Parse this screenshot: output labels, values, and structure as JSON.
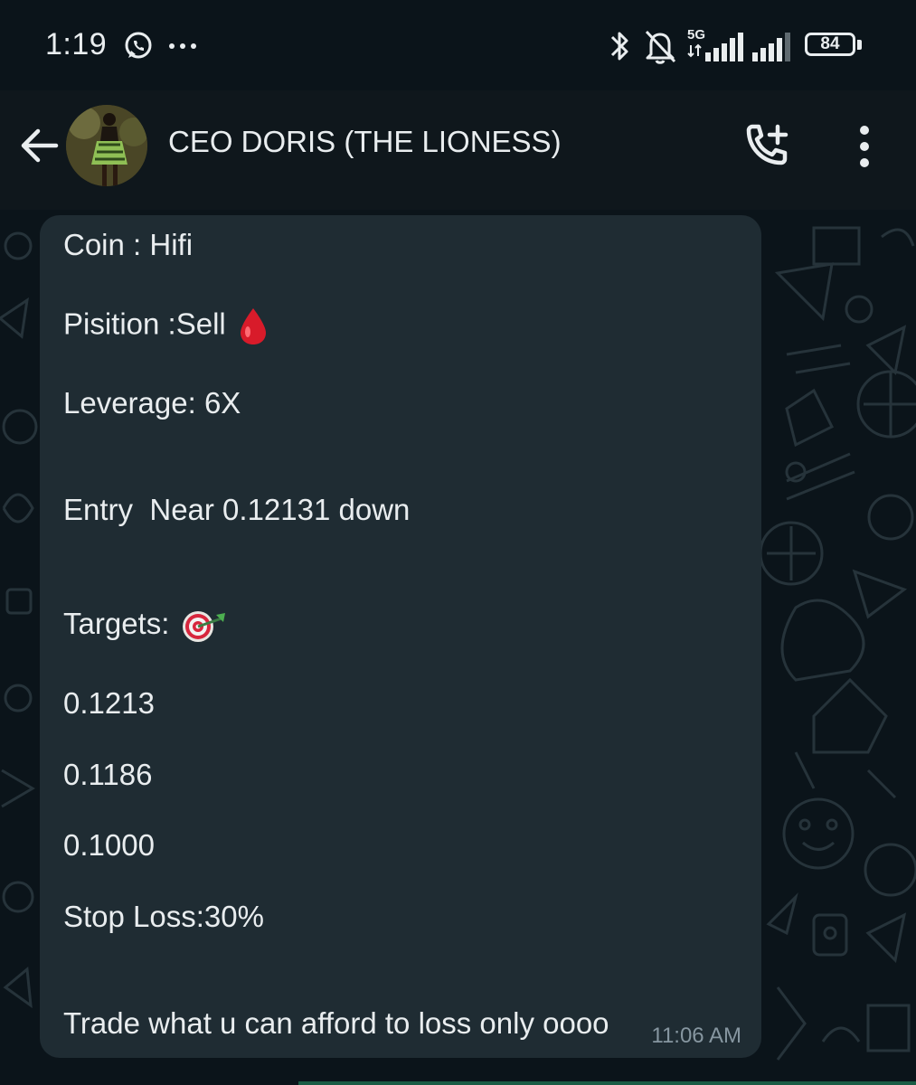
{
  "status_bar": {
    "time": "1:19",
    "network": "5G",
    "battery": "84",
    "icons": [
      "whatsapp-icon",
      "more-dots-icon",
      "bluetooth-icon",
      "bell-off-icon",
      "signal-5g-icon",
      "signal-icon",
      "battery-icon"
    ]
  },
  "header": {
    "contact_name": "CEO DORIS (THE LIONESS)",
    "icons": [
      "back-arrow-icon",
      "add-call-icon",
      "more-vert-icon"
    ]
  },
  "message": {
    "lines": [
      "Coin : Hifi",
      "Pisition :Sell",
      "Leverage: 6X",
      "Entry  Near 0.12131 down",
      "Targets:",
      "0.1213",
      "0.1186",
      "0.1000",
      "Stop Loss:30%",
      "Trade what u can afford to loss only oooo"
    ],
    "emojis": [
      "drop-of-blood-emoji",
      "direct-hit-emoji"
    ],
    "time": "11:06 AM"
  },
  "colors": {
    "background": "#0b141a",
    "header": "#0f171c",
    "bubble": "#1f2c33",
    "text": "#e9edef",
    "meta_text": "#8696a0"
  }
}
